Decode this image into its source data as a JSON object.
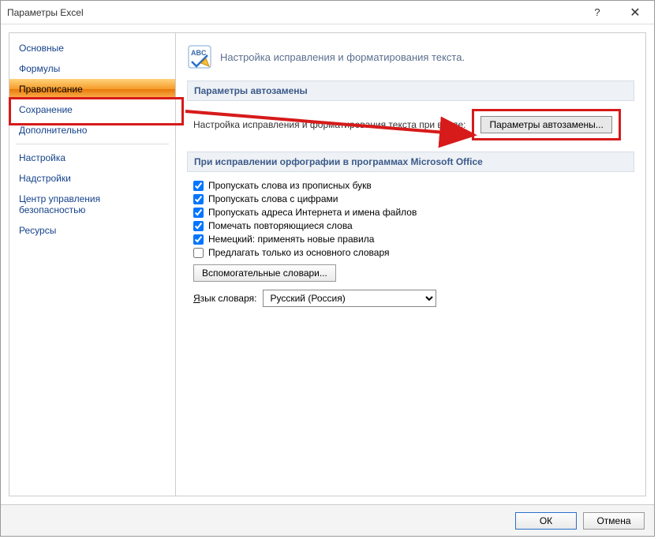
{
  "titlebar": {
    "title": "Параметры Excel"
  },
  "sidebar": {
    "items": [
      {
        "label": "Основные"
      },
      {
        "label": "Формулы"
      },
      {
        "label": "Правописание",
        "selected": true
      },
      {
        "label": "Сохранение"
      },
      {
        "label": "Дополнительно"
      },
      {
        "label": "Настройка"
      },
      {
        "label": "Надстройки"
      },
      {
        "label": "Центр управления безопасностью"
      },
      {
        "label": "Ресурсы"
      }
    ]
  },
  "content": {
    "header": "Настройка исправления и форматирования текста.",
    "section1": {
      "title": "Параметры автозамены",
      "desc": "Настройка исправления и форматирования текста при вводе:",
      "button": "Параметры автозамены..."
    },
    "section2": {
      "title": "При исправлении орфографии в программах Microsoft Office",
      "checks": [
        {
          "label": "Пропускать слова из прописных букв",
          "checked": true
        },
        {
          "label": "Пропускать слова с цифрами",
          "checked": true
        },
        {
          "label": "Пропускать адреса Интернета и имена файлов",
          "checked": true
        },
        {
          "label": "Помечать повторяющиеся слова",
          "checked": true
        },
        {
          "label": "Немецкий: применять новые правила",
          "checked": true
        },
        {
          "label": "Предлагать только из основного словаря",
          "checked": false
        }
      ],
      "dict_button": "Вспомогательные словари...",
      "lang_label": "Язык словаря:",
      "lang_value": "Русский (Россия)"
    }
  },
  "footer": {
    "ok": "ОК",
    "cancel": "Отмена"
  }
}
